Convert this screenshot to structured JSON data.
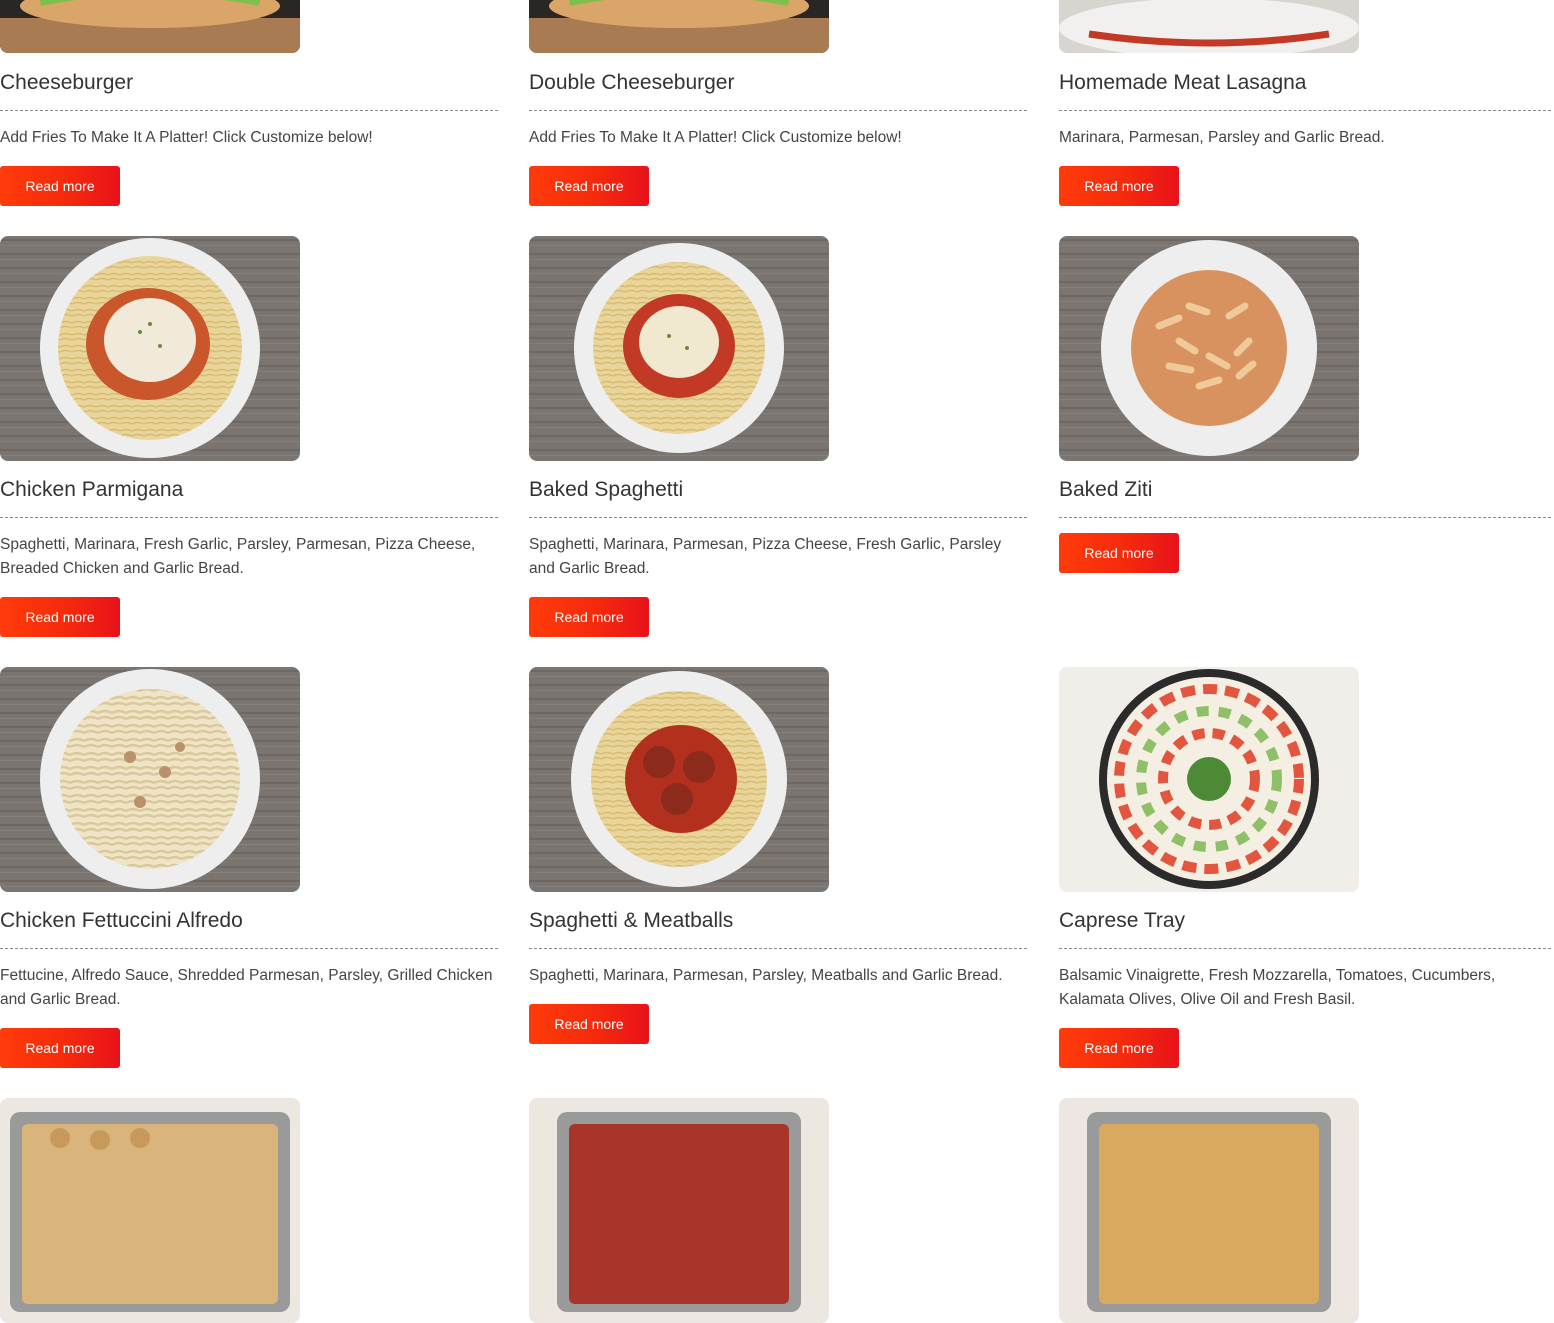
{
  "accent_gradient": [
    "#ff3b0a",
    "#e8121a"
  ],
  "button_label": "Read more",
  "rows": [
    {
      "items": [
        {
          "title": "Cheeseburger",
          "description": "Add Fries To Make It A Platter! Click Customize below!",
          "image": "burger-photo"
        },
        {
          "title": "Double Cheeseburger",
          "description": "Add Fries To Make It A Platter! Click Customize below!",
          "image": "burger-photo"
        },
        {
          "title": "Homemade Meat Lasagna",
          "description": "Marinara, Parmesan, Parsley and Garlic Bread.",
          "image": "lasagna-photo"
        }
      ]
    },
    {
      "items": [
        {
          "title": "Chicken Parmigana",
          "description": "Spaghetti, Marinara, Fresh Garlic, Parsley, Parmesan, Pizza Cheese, Breaded Chicken and Garlic Bread.",
          "image": "chicken-parm-photo"
        },
        {
          "title": "Baked Spaghetti",
          "description": "Spaghetti, Marinara, Parmesan, Pizza Cheese, Fresh Garlic, Parsley and Garlic Bread.",
          "image": "baked-spaghetti-photo"
        },
        {
          "title": "Baked Ziti",
          "description": "",
          "image": "baked-ziti-photo"
        }
      ]
    },
    {
      "items": [
        {
          "title": "Chicken Fettuccini Alfredo",
          "description": "Fettucine, Alfredo Sauce, Shredded Parmesan, Parsley, Grilled Chicken and Garlic Bread.",
          "image": "alfredo-photo"
        },
        {
          "title": "Spaghetti & Meatballs",
          "description": "Spaghetti, Marinara, Parmesan, Parsley, Meatballs and Garlic Bread.",
          "image": "meatballs-photo"
        },
        {
          "title": "Caprese Tray",
          "description": "Balsamic Vinaigrette, Fresh Mozzarella, Tomatoes, Cucumbers, Kalamata Olives, Olive Oil and Fresh Basil.",
          "image": "caprese-photo"
        }
      ]
    },
    {
      "items": [
        {
          "title": "",
          "description": "",
          "image": "garlic-knots-tray-photo"
        },
        {
          "title": "",
          "description": "",
          "image": "meat-tray-photo"
        },
        {
          "title": "",
          "description": "",
          "image": "fries-tray-photo"
        }
      ]
    }
  ]
}
